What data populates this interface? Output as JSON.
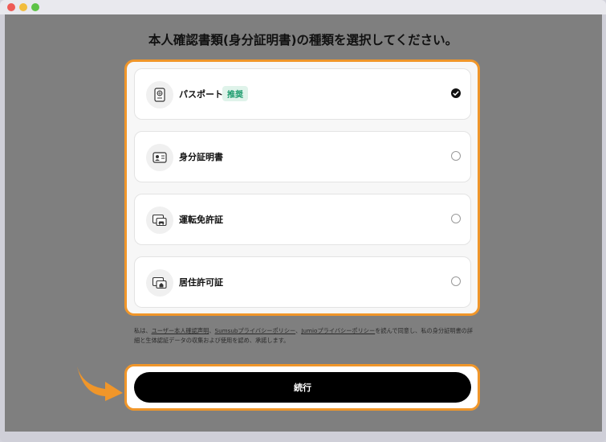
{
  "page": {
    "title": "本人確認書類(身分証明書)の種類を選択してください。"
  },
  "options": [
    {
      "label": "パスポート",
      "badge": "推奨",
      "selected": true,
      "icon": "passport-icon"
    },
    {
      "label": "身分証明書",
      "selected": false,
      "icon": "id-card-icon"
    },
    {
      "label": "運転免許証",
      "selected": false,
      "icon": "driver-license-icon"
    },
    {
      "label": "居住許可証",
      "selected": false,
      "icon": "residence-permit-icon"
    }
  ],
  "consent": {
    "prefix": "私は、",
    "link1": "ユーザー本人確認声明",
    "sep1": "、",
    "link2": "Sumsubプライバシーポリシー",
    "sep2": "、",
    "link3": "Jumioプライバシーポリシー",
    "suffix": "を読んで同意し、私の身分証明書の詳細と生体認証データの収集および使用を認め、承諾します。"
  },
  "actions": {
    "continue_label": "続行"
  },
  "colors": {
    "highlight": "#f0962a",
    "badge_text": "#1a9b6c",
    "badge_bg": "#dff3ea",
    "button_bg": "#000000"
  }
}
